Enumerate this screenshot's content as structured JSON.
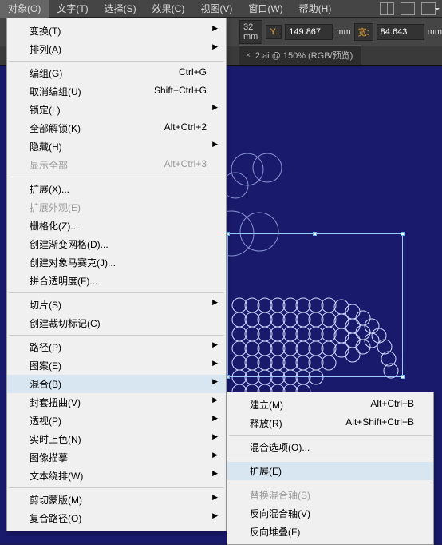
{
  "menubar": {
    "items": [
      {
        "label": "对象(O)"
      },
      {
        "label": "文字(T)"
      },
      {
        "label": "选择(S)"
      },
      {
        "label": "效果(C)"
      },
      {
        "label": "视图(V)"
      },
      {
        "label": "窗口(W)"
      },
      {
        "label": "帮助(H)"
      }
    ]
  },
  "propbar": {
    "x_unit": "32 mm",
    "y_label": "Y:",
    "y_value": "149.867",
    "w_label": "宽:",
    "w_value": "84.643",
    "unit": "mm"
  },
  "tabs": {
    "divider": "×",
    "label": "2.ai @ 150% (RGB/预览)"
  },
  "menu": {
    "items": [
      {
        "label": "变换(T)",
        "sub": true
      },
      {
        "label": "排列(A)",
        "sub": true
      },
      {
        "sep": true
      },
      {
        "label": "编组(G)",
        "shortcut": "Ctrl+G"
      },
      {
        "label": "取消编组(U)",
        "shortcut": "Shift+Ctrl+G"
      },
      {
        "label": "锁定(L)",
        "sub": true
      },
      {
        "label": "全部解锁(K)",
        "shortcut": "Alt+Ctrl+2"
      },
      {
        "label": "隐藏(H)",
        "sub": true
      },
      {
        "label": "显示全部",
        "shortcut": "Alt+Ctrl+3",
        "disabled": true
      },
      {
        "sep": true
      },
      {
        "label": "扩展(X)..."
      },
      {
        "label": "扩展外观(E)",
        "disabled": true
      },
      {
        "label": "栅格化(Z)..."
      },
      {
        "label": "创建渐变网格(D)..."
      },
      {
        "label": "创建对象马赛克(J)..."
      },
      {
        "label": "拼合透明度(F)..."
      },
      {
        "sep": true
      },
      {
        "label": "切片(S)",
        "sub": true
      },
      {
        "label": "创建裁切标记(C)"
      },
      {
        "sep": true
      },
      {
        "label": "路径(P)",
        "sub": true
      },
      {
        "label": "图案(E)",
        "sub": true
      },
      {
        "label": "混合(B)",
        "sub": true,
        "highlighted": true
      },
      {
        "label": "封套扭曲(V)",
        "sub": true
      },
      {
        "label": "透视(P)",
        "sub": true
      },
      {
        "label": "实时上色(N)",
        "sub": true
      },
      {
        "label": "图像描摹",
        "sub": true
      },
      {
        "label": "文本绕排(W)",
        "sub": true
      },
      {
        "sep": true
      },
      {
        "label": "剪切蒙版(M)",
        "sub": true
      },
      {
        "label": "复合路径(O)",
        "sub": true
      }
    ]
  },
  "submenu": {
    "items": [
      {
        "label": "建立(M)",
        "shortcut": "Alt+Ctrl+B"
      },
      {
        "label": "释放(R)",
        "shortcut": "Alt+Shift+Ctrl+B"
      },
      {
        "sep": true
      },
      {
        "label": "混合选项(O)..."
      },
      {
        "sep": true
      },
      {
        "label": "扩展(E)",
        "highlighted": true
      },
      {
        "sep": true
      },
      {
        "label": "替换混合轴(S)",
        "disabled": true
      },
      {
        "label": "反向混合轴(V)"
      },
      {
        "label": "反向堆叠(F)"
      }
    ]
  }
}
